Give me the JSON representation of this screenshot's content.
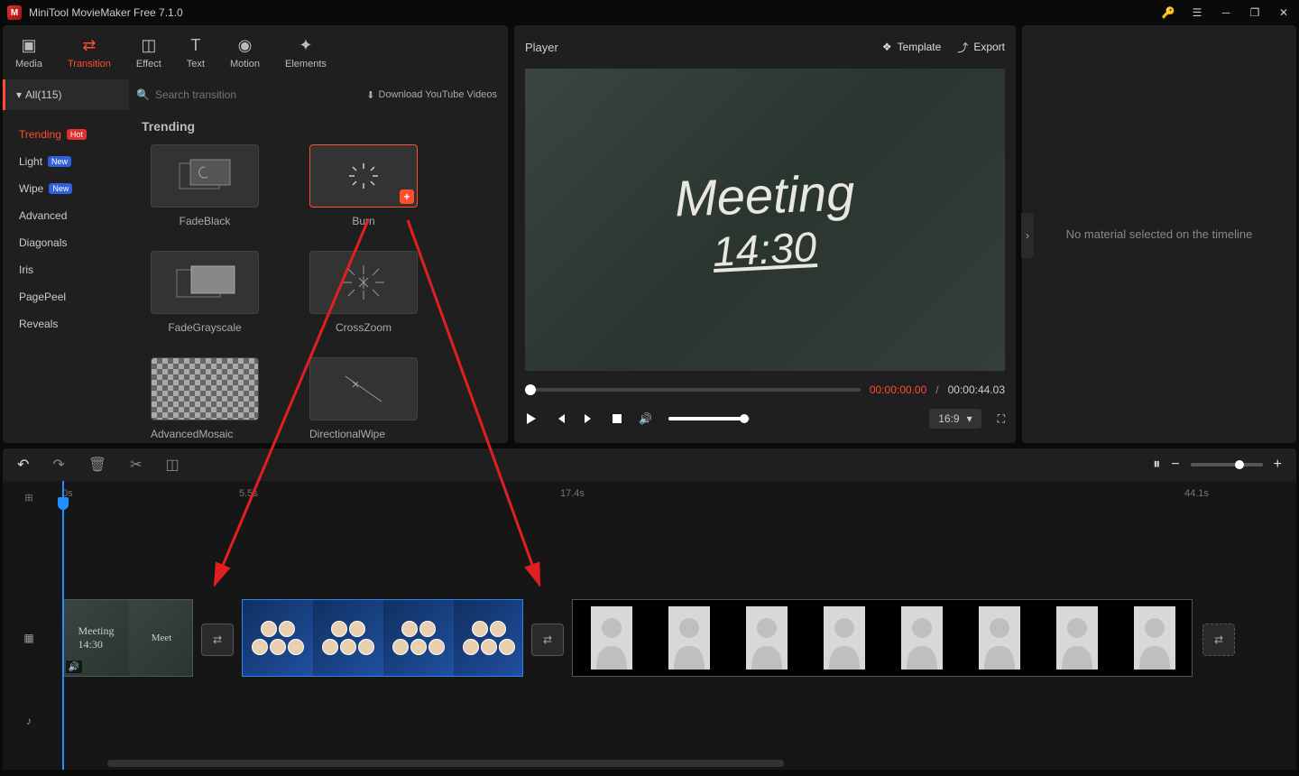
{
  "app": {
    "title": "MiniTool MovieMaker Free 7.1.0"
  },
  "tabs": {
    "media": "Media",
    "transition": "Transition",
    "effect": "Effect",
    "text": "Text",
    "motion": "Motion",
    "elements": "Elements"
  },
  "filter": {
    "all": "All(115)"
  },
  "search": {
    "placeholder": "Search transition"
  },
  "download_link": "Download YouTube Videos",
  "categories": [
    {
      "label": "Trending",
      "badge": "Hot",
      "active": true
    },
    {
      "label": "Light",
      "badge": "New"
    },
    {
      "label": "Wipe",
      "badge": "New"
    },
    {
      "label": "Advanced"
    },
    {
      "label": "Diagonals"
    },
    {
      "label": "Iris"
    },
    {
      "label": "PagePeel"
    },
    {
      "label": "Reveals"
    }
  ],
  "gallery": {
    "heading": "Trending",
    "items": [
      {
        "label": "FadeBlack",
        "kind": "fadeblack"
      },
      {
        "label": "Burn",
        "kind": "burn",
        "selected": true
      },
      {
        "label": "FadeGrayscale",
        "kind": "fadegray"
      },
      {
        "label": "CrossZoom",
        "kind": "crosszoom"
      },
      {
        "label": "AdvancedMosaic",
        "kind": "mosaic"
      },
      {
        "label": "DirectionalWipe",
        "kind": "dirwipe"
      }
    ]
  },
  "player": {
    "title": "Player",
    "template_btn": "Template",
    "export_btn": "Export",
    "time_current": "00:00:00.00",
    "time_total": "00:00:44.03",
    "aspect": "16:9",
    "preview_line1": "Meeting",
    "preview_line2": "14:30"
  },
  "right_panel": {
    "message": "No material selected on the timeline"
  },
  "timeline": {
    "marks": [
      "0s",
      "5.5s",
      "17.4s",
      "44.1s"
    ],
    "mark_positions": [
      8,
      204,
      560,
      1252
    ]
  }
}
